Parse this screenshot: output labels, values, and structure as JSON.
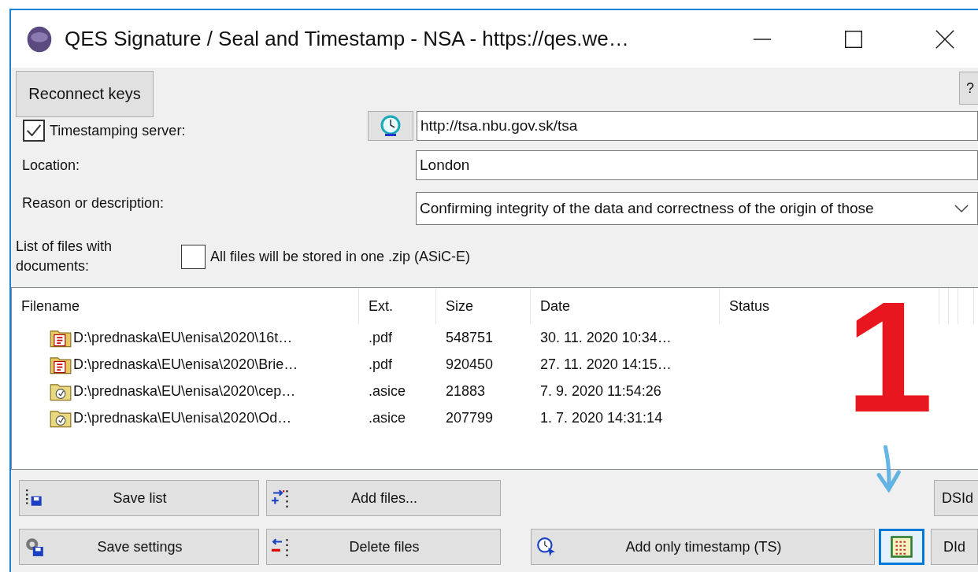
{
  "window": {
    "title": "QES Signature / Seal and Timestamp - NSA - https://qes.we…"
  },
  "reconnect_button": "Reconnect keys",
  "help_button": "?",
  "timestamping": {
    "label": "Timestamping server:",
    "checked": true,
    "value": "http://tsa.nbu.gov.sk/tsa"
  },
  "location": {
    "label": "Location:",
    "value": "London"
  },
  "reason": {
    "label": "Reason or description:",
    "value": "Confirming integrity of the data and correctness of the origin of those"
  },
  "files_label": "List of files with documents:",
  "zip_option": {
    "label": "All files will be stored in one .zip  (ASiC-E)",
    "checked": false
  },
  "table": {
    "columns": [
      "Filename",
      "Ext.",
      "Size",
      "Date",
      "Status"
    ],
    "rows": [
      {
        "kind": "pdf",
        "cells": [
          "D:\\prednaska\\EU\\enisa\\2020\\16t…",
          ".pdf",
          "548751",
          "30. 11. 2020 10:34…"
        ]
      },
      {
        "kind": "pdf",
        "cells": [
          "D:\\prednaska\\EU\\enisa\\2020\\Brie…",
          ".pdf",
          "920450",
          "27. 11. 2020 14:15…"
        ]
      },
      {
        "kind": "asice",
        "cells": [
          "D:\\prednaska\\EU\\enisa\\2020\\cep…",
          ".asice",
          "21883",
          "7. 9. 2020 11:54:26"
        ]
      },
      {
        "kind": "asice",
        "cells": [
          "D:\\prednaska\\EU\\enisa\\2020\\Od…",
          ".asice",
          "207799",
          "1. 7. 2020 14:31:14"
        ]
      }
    ]
  },
  "buttons_row1": [
    {
      "kind": "save-list",
      "label": "Save list"
    },
    {
      "kind": "add-files",
      "label": "Add files..."
    }
  ],
  "buttons_row2": [
    {
      "kind": "save-settings",
      "label": "Save settings"
    },
    {
      "kind": "delete-files",
      "label": "Delete files"
    }
  ],
  "timestamp_button": "Add only timestamp (TS)",
  "side_buttons": [
    "DSId",
    "DId"
  ],
  "annotation": {
    "number": "1"
  }
}
